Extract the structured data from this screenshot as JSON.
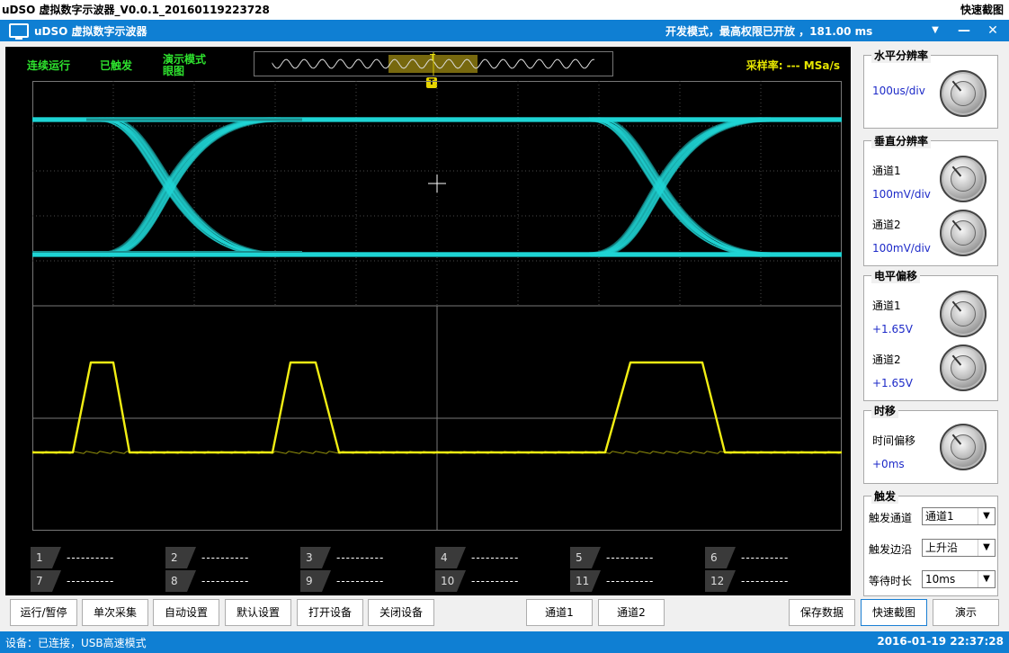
{
  "outer_window": {
    "title": "uDSO 虚拟数字示波器_V0.0.1_20160119223728",
    "quick_capture": "快速截图"
  },
  "app_bar": {
    "title": "uDSO 虚拟数字示波器",
    "status": "开发模式，最高权限已开放 ，181.00 ms",
    "menu_glyph": "▼",
    "minimize_glyph": "—",
    "close_glyph": "✕"
  },
  "scope": {
    "run_state": "连续运行",
    "trigger_state": "已触发",
    "mode_line1": "演示模式",
    "mode_line2": "眼图",
    "sample_rate": "采样率: --- MSa/s",
    "trigger_marker": "T",
    "trigger_top_marker": "T"
  },
  "colors": {
    "ch1": "#1fd6d6",
    "ch2": "#f2ee13",
    "grid": "#4a4a4a",
    "background": "#000000",
    "accent": "#0f7fd3"
  },
  "measurements": [
    {
      "num": "1",
      "value": "----------"
    },
    {
      "num": "2",
      "value": "----------"
    },
    {
      "num": "3",
      "value": "----------"
    },
    {
      "num": "4",
      "value": "----------"
    },
    {
      "num": "5",
      "value": "----------"
    },
    {
      "num": "6",
      "value": "----------"
    },
    {
      "num": "7",
      "value": "----------"
    },
    {
      "num": "8",
      "value": "----------"
    },
    {
      "num": "9",
      "value": "----------"
    },
    {
      "num": "10",
      "value": "----------"
    },
    {
      "num": "11",
      "value": "----------"
    },
    {
      "num": "12",
      "value": "----------"
    }
  ],
  "panel": {
    "horizontal": {
      "title": "水平分辨率",
      "value": "100us/div"
    },
    "vertical": {
      "title": "垂直分辨率",
      "ch1_label": "通道1",
      "ch1_value": "100mV/div",
      "ch2_label": "通道2",
      "ch2_value": "100mV/div"
    },
    "offset": {
      "title": "电平偏移",
      "ch1_label": "通道1",
      "ch1_value": "+1.65V",
      "ch2_label": "通道2",
      "ch2_value": "+1.65V"
    },
    "time_shift": {
      "title": "时移",
      "label": "时间偏移",
      "value": "+0ms"
    },
    "trigger": {
      "title": "触发",
      "channel_label": "触发通道",
      "channel_value": "通道1",
      "edge_label": "触发边沿",
      "edge_value": "上升沿",
      "wait_label": "等待时长",
      "wait_value": "10ms"
    }
  },
  "buttons": {
    "run_pause": "运行/暂停",
    "single": "单次采集",
    "auto": "自动设置",
    "default": "默认设置",
    "open_device": "打开设备",
    "close_device": "关闭设备",
    "ch1": "通道1",
    "ch2": "通道2",
    "save": "保存数据",
    "screenshot": "快速截图",
    "demo": "演示"
  },
  "status_bar": {
    "connection": "设备：已连接，USB高速模式",
    "datetime": "2016-01-19 22:37:28"
  }
}
